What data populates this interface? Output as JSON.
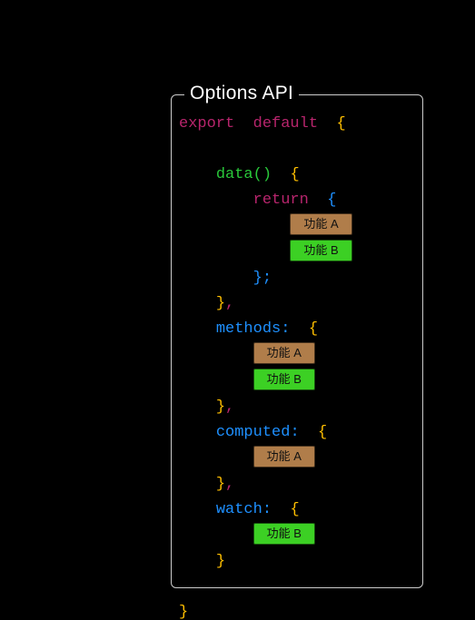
{
  "panel": {
    "title": "Options API"
  },
  "tokens": {
    "export": "export",
    "default": "default",
    "return": "return",
    "lbrace": "{",
    "rbrace": "}",
    "lparen": "(",
    "rparen": ")",
    "semicolon": ";",
    "colon": ":",
    "comma": ","
  },
  "sections": {
    "data": "data",
    "methods": "methods",
    "computed": "computed",
    "watch": "watch"
  },
  "pills": {
    "featureA": "功能 A",
    "featureB": "功能 B"
  }
}
